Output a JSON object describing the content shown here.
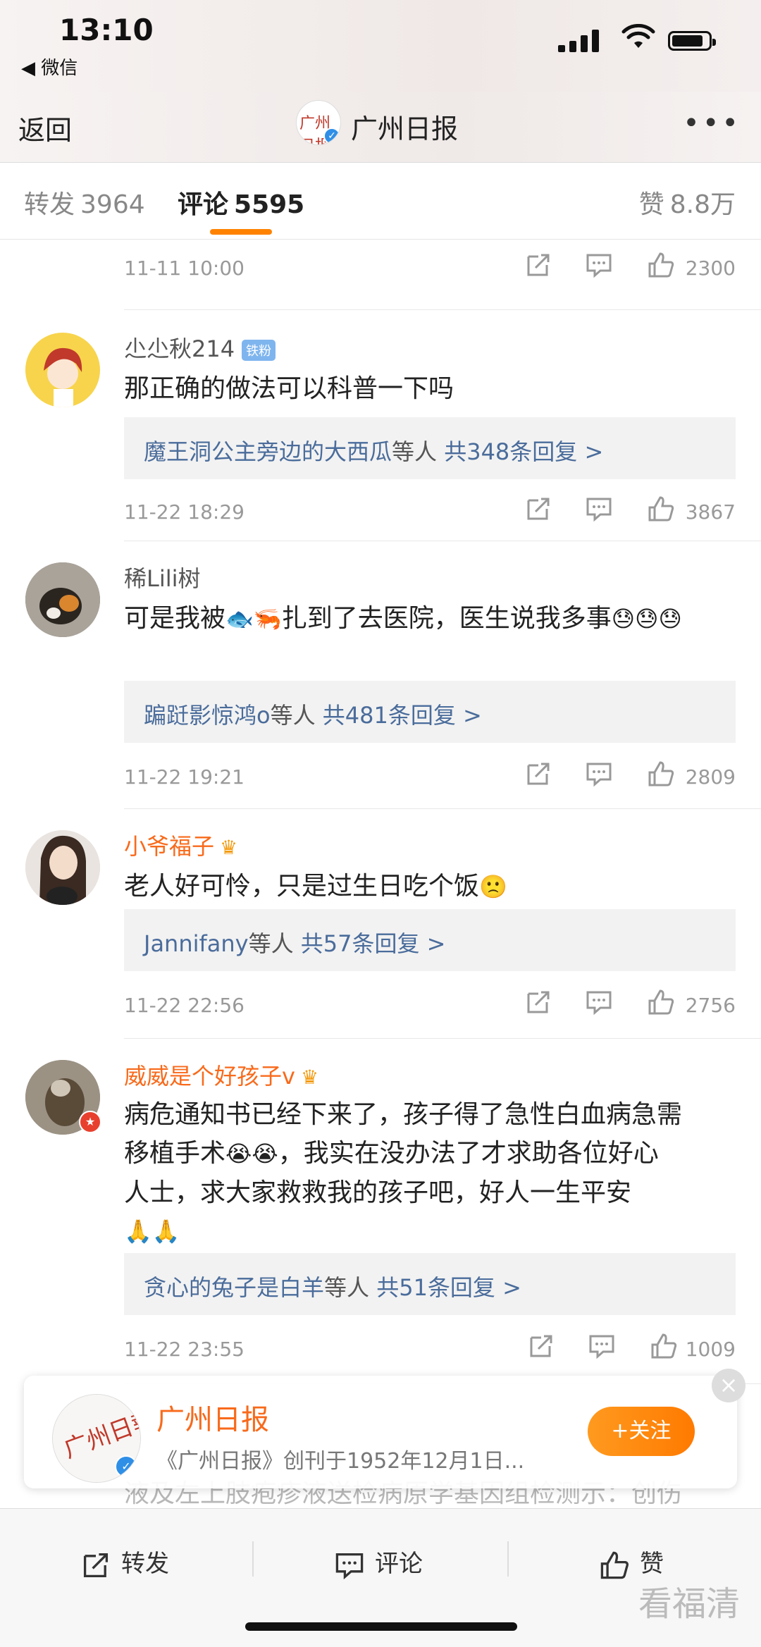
{
  "status": {
    "time": "13:10",
    "back_app": "◀ 微信"
  },
  "nav": {
    "back_label": "返回",
    "title": "广州日报",
    "more": "•••",
    "avatar_text": "广州日报"
  },
  "tabs": {
    "repost": {
      "label": "转发",
      "count": "3964"
    },
    "comment": {
      "label": "评论",
      "count": "5595"
    },
    "like": {
      "label": "赞",
      "count": "8.8万"
    }
  },
  "partial_meta": {
    "date": "11-11 10:00",
    "likes": "2300"
  },
  "comments": [
    {
      "user": "尐尐秋214",
      "badge": "铁粉",
      "text": "那正确的做法可以科普一下吗",
      "reply_user": "魔王洞公主旁边的大西瓜",
      "reply_others": "等人",
      "reply_count": "共348条回复 >",
      "date": "11-22 18:29",
      "likes": "3867"
    },
    {
      "user": "稀Lili树",
      "text_a": "可是我被",
      "emoji_1": "🐟🦐",
      "text_b": "扎到了去医院，医生说我多事",
      "emoji_2": "😓😓😓",
      "reply_user": "蹁跹影惊鸿o",
      "reply_others": "等人",
      "reply_count": "共481条回复 >",
      "date": "11-22 19:21",
      "likes": "2809"
    },
    {
      "user": "小爷福子",
      "text": "老人好可怜，只是过生日吃个饭",
      "emoji": "🙁",
      "reply_user": "Jannifany",
      "reply_others": "等人",
      "reply_count": "共57条回复 >",
      "date": "11-22 22:56",
      "likes": "2756"
    },
    {
      "user": "威威是个好孩子v",
      "line1": "病危通知书已经下来了，孩子得了急性白血病急需",
      "line2a": "移植手术",
      "emoji_a": "😭😭",
      "line2b": "，我实在没办法了才求助各位好心",
      "line3": "人士，求大家救救我的孩子吧，好人一生平安",
      "emoji_b": "🙏🙏",
      "reply_user": "贪心的兔子是白羊",
      "reply_others": "等人",
      "reply_count": "共51条回复 >",
      "date": "11-22 23:55",
      "likes": "1009"
    }
  ],
  "follow_card": {
    "name": "广州日报",
    "desc": "《广州日报》创刊于1952年12月1日...",
    "button": "+关注",
    "close": "×"
  },
  "behind_text": "液及左上肢疱疹液送检病原学基因组检测示：创伤",
  "bottom": {
    "repost": "转发",
    "comment": "评论",
    "like": "赞"
  },
  "watermark": "看福清"
}
